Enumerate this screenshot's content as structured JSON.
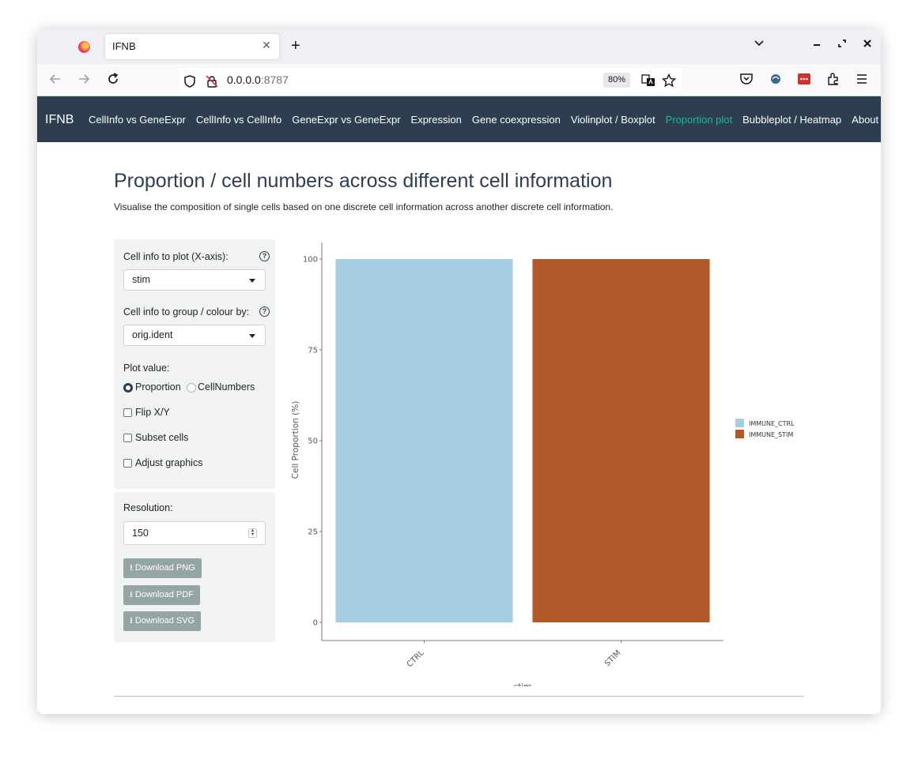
{
  "browser": {
    "tab_title": "IFNB",
    "tab_close": "✕",
    "new_tab": "+",
    "url_host": "0.0.0.0",
    "url_port": ":8787",
    "zoom": "80%"
  },
  "app": {
    "brand": "IFNB",
    "nav": [
      {
        "label": "CellInfo vs GeneExpr",
        "active": false
      },
      {
        "label": "CellInfo vs CellInfo",
        "active": false
      },
      {
        "label": "GeneExpr vs GeneExpr",
        "active": false
      },
      {
        "label": "Expression",
        "active": false
      },
      {
        "label": "Gene coexpression",
        "active": false
      },
      {
        "label": "Violinplot / Boxplot",
        "active": false
      },
      {
        "label": "Proportion plot",
        "active": true
      },
      {
        "label": "Bubbleplot / Heatmap",
        "active": false
      },
      {
        "label": "About",
        "active": false
      }
    ],
    "accent_color": "#18bc9c",
    "navbar_color": "#2c3e50"
  },
  "page": {
    "title": "Proportion / cell numbers across different cell information",
    "subtitle": "Visualise the composition of single cells based on one discrete cell information across another discrete cell information."
  },
  "controls": {
    "x_label": "Cell info to plot (X-axis):",
    "x_value": "stim",
    "group_label": "Cell info to group / colour by:",
    "group_value": "orig.ident",
    "help": "?",
    "plot_value_label": "Plot value:",
    "radio_proportion": "Proportion",
    "radio_cellnumbers": "CellNumbers",
    "flip_label": "Flip X/Y",
    "subset_label": "Subset cells",
    "adjust_label": "Adjust graphics",
    "resolution_label": "Resolution:",
    "resolution_value": "150",
    "download_png": "⭳ Download PNG",
    "download_pdf": "⭳ Download PDF",
    "download_svg": "⭳ Download SVG"
  },
  "chart_data": {
    "type": "bar",
    "categories": [
      "CTRL",
      "STIM"
    ],
    "series": [
      {
        "name": "IMMUNE_CTRL",
        "color": "#a6cee3",
        "values": [
          100,
          0
        ]
      },
      {
        "name": "IMMUNE_STIM",
        "color": "#b15928",
        "values": [
          0,
          100
        ]
      }
    ],
    "xlabel": "stim",
    "ylabel": "Cell Proportion (%)",
    "ylim": [
      0,
      100
    ],
    "yticks": [
      0,
      25,
      50,
      75,
      100
    ],
    "stacked": true,
    "legend": "right",
    "grid": false
  }
}
